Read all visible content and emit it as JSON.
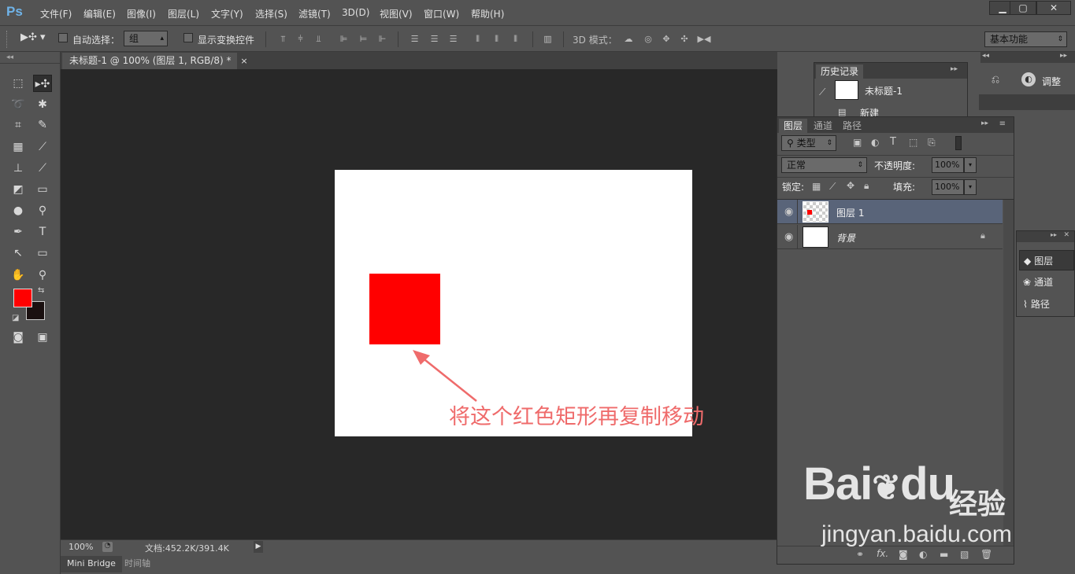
{
  "app": {
    "logo": "Ps",
    "menu": [
      "文件(F)",
      "编辑(E)",
      "图像(I)",
      "图层(L)",
      "文字(Y)",
      "选择(S)",
      "滤镜(T)",
      "3D(D)",
      "视图(V)",
      "窗口(W)",
      "帮助(H)"
    ],
    "window_buttons": {
      "minimize": "▁",
      "restore": "▢",
      "close": "✕"
    }
  },
  "options_bar": {
    "auto_select_label": "自动选择：",
    "auto_select_value": "组",
    "show_transform_label": "显示变换控件",
    "mode_3d_label": "3D 模式：",
    "workspace": "基本功能"
  },
  "document": {
    "tab_title": "未标题-1 @ 100% (图层 1, RGB/8) *",
    "tab_close": "×",
    "canvas_bg": "#ffffff",
    "shape_color": "#ff0000",
    "annotation": "将这个红色矩形再复制移动",
    "annotation_color": "#ef6b6b"
  },
  "status_bar": {
    "zoom": "100%",
    "doc_info": "文档:452.2K/391.4K"
  },
  "bottom_tabs": [
    "Mini Bridge",
    "时间轴"
  ],
  "toolbox": {
    "foreground_color": "#ff0000",
    "background_color": "#1a1010"
  },
  "history_panel": {
    "tab": "历史记录",
    "items": [
      "未标题-1",
      "新建"
    ]
  },
  "side_panel_top": {
    "adjust_label": "调整"
  },
  "layers_panel": {
    "tabs": [
      "图层",
      "通道",
      "路径"
    ],
    "filter_type": "类型",
    "blend_mode": "正常",
    "opacity_label": "不透明度:",
    "opacity_value": "100%",
    "lock_label": "锁定:",
    "fill_label": "填充:",
    "fill_value": "100%",
    "layers": [
      {
        "name": "图层 1",
        "selected": true
      },
      {
        "name": "背景",
        "selected": false
      }
    ],
    "footer_fx": "fx."
  },
  "collapsed_panel": {
    "items": [
      "图层",
      "通道",
      "路径"
    ]
  },
  "watermark": {
    "brand": "Bai",
    "brand_du": "du",
    "brand_cn": "经验",
    "url": "jingyan.baidu.com"
  }
}
